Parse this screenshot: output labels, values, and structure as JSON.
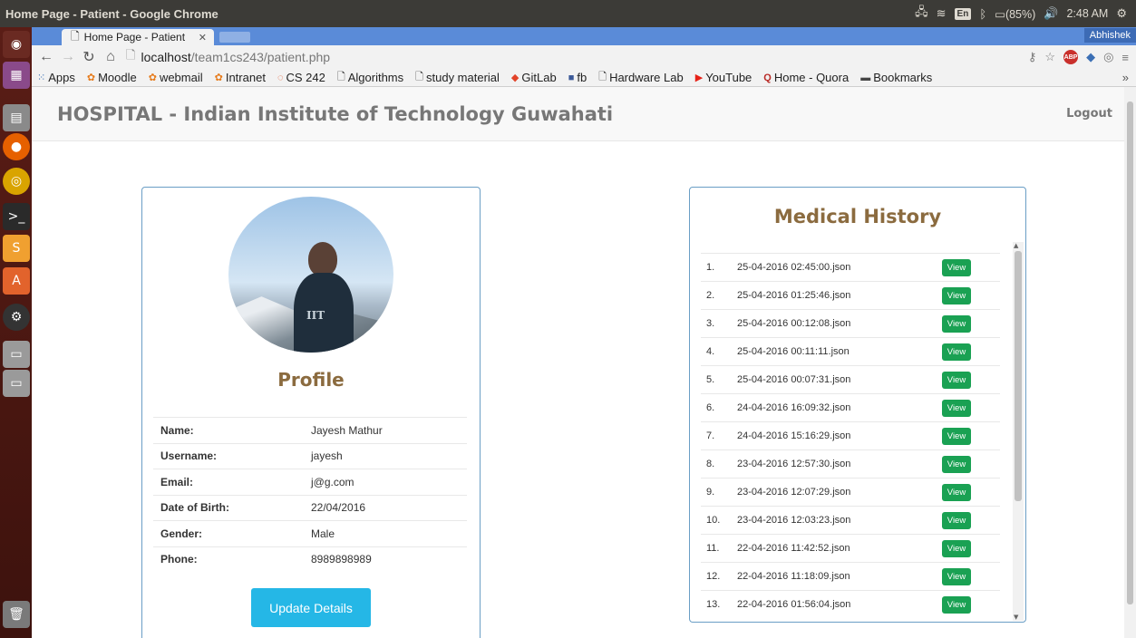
{
  "os": {
    "window_title": "Home Page - Patient - Google Chrome",
    "lang": "En",
    "battery": "(85%)",
    "time": "2:48 AM"
  },
  "browser": {
    "tab_title": "Home Page - Patient",
    "profile_name": "Abhishek",
    "url_host": "localhost",
    "url_path": "/team1cs243/patient.php",
    "bookmarks": [
      "Apps",
      "Moodle",
      "webmail",
      "Intranet",
      "CS 242",
      "Algorithms",
      "study material",
      "GitLab",
      "fb",
      "Hardware Lab",
      "YouTube",
      "Home - Quora",
      "Bookmarks"
    ],
    "more": "»"
  },
  "navbar": {
    "brand": "HOSPITAL - Indian Institute of Technology Guwahati",
    "logout": "Logout"
  },
  "profile": {
    "title": "Profile",
    "shirt_text": "IIT",
    "rows": [
      {
        "key": "Name:",
        "value": "Jayesh Mathur"
      },
      {
        "key": "Username:",
        "value": "jayesh"
      },
      {
        "key": "Email:",
        "value": "j@g.com"
      },
      {
        "key": "Date of Birth:",
        "value": "22/04/2016"
      },
      {
        "key": "Gender:",
        "value": "Male"
      },
      {
        "key": "Phone:",
        "value": "8989898989"
      }
    ],
    "update_button": "Update Details"
  },
  "history": {
    "title": "Medical History",
    "view_label": "View",
    "items": [
      {
        "num": "1.",
        "file": "25-04-2016 02:45:00.json"
      },
      {
        "num": "2.",
        "file": "25-04-2016 01:25:46.json"
      },
      {
        "num": "3.",
        "file": "25-04-2016 00:12:08.json"
      },
      {
        "num": "4.",
        "file": "25-04-2016 00:11:11.json"
      },
      {
        "num": "5.",
        "file": "25-04-2016 00:07:31.json"
      },
      {
        "num": "6.",
        "file": "24-04-2016 16:09:32.json"
      },
      {
        "num": "7.",
        "file": "24-04-2016 15:16:29.json"
      },
      {
        "num": "8.",
        "file": "23-04-2016 12:57:30.json"
      },
      {
        "num": "9.",
        "file": "23-04-2016 12:07:29.json"
      },
      {
        "num": "10.",
        "file": "23-04-2016 12:03:23.json"
      },
      {
        "num": "11.",
        "file": "22-04-2016 11:42:52.json"
      },
      {
        "num": "12.",
        "file": "22-04-2016 11:18:09.json"
      },
      {
        "num": "13.",
        "file": "22-04-2016 01:56:04.json"
      }
    ]
  },
  "colors": {
    "brand_heading": "#8b6b3f",
    "update_button": "#25b7e6",
    "view_button": "#1aa153",
    "card_border": "#6a9ec5"
  }
}
